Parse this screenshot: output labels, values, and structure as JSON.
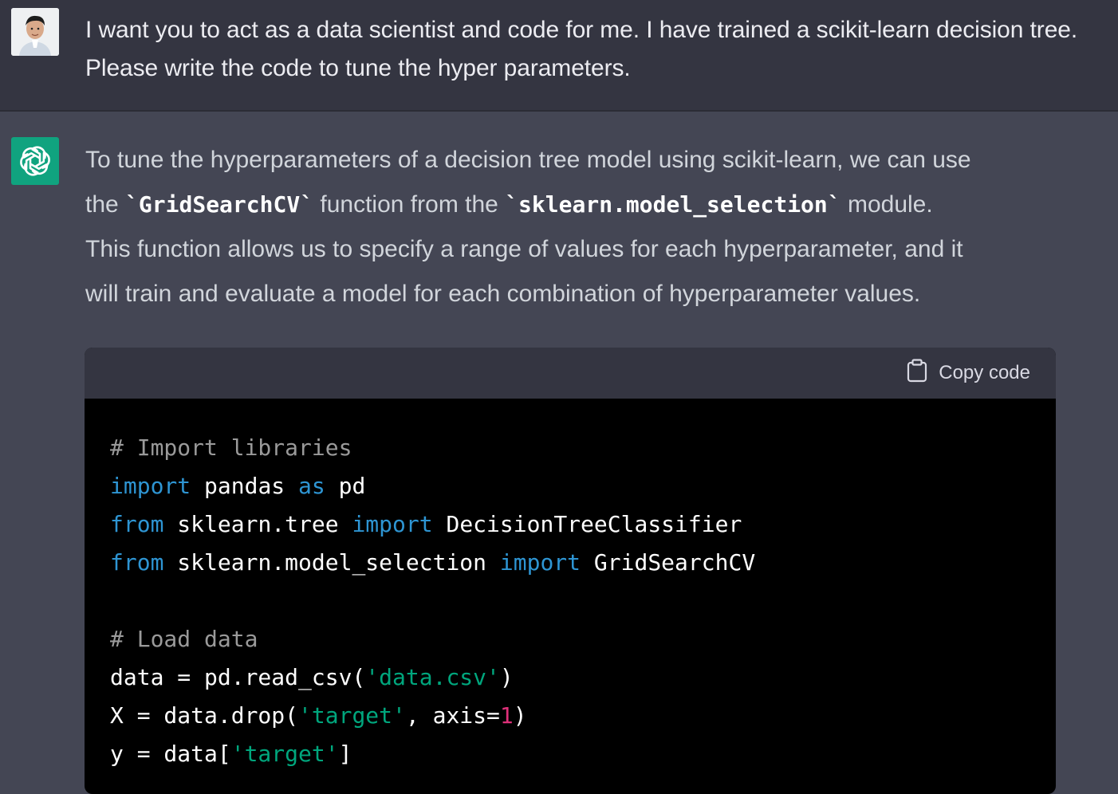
{
  "user_message": {
    "text": "I want you to act as a data scientist and code for me. I have trained a scikit-learn decision tree. Please write the code to tune the hyper parameters."
  },
  "assistant_message": {
    "intro_1": "To tune the hyperparameters of a decision tree model using scikit-learn, we can use",
    "intro_2a": "the ",
    "code_1": "`GridSearchCV`",
    "intro_2b": " function from the ",
    "code_2": "`sklearn.model_selection`",
    "intro_2c": " module.",
    "intro_3": "This function allows us to specify a range of values for each hyperparameter, and it",
    "intro_4": "will train and evaluate a model for each combination of hyperparameter values."
  },
  "code_block": {
    "copy_label": "Copy code",
    "tokens": {
      "c1": "# Import libraries",
      "kw_import": "import",
      "t_pandas": " pandas ",
      "kw_as": "as",
      "t_pd": " pd",
      "kw_from": "from",
      "t_tree": " sklearn.tree ",
      "t_dtc": " DecisionTreeClassifier",
      "t_ms": " sklearn.model_selection ",
      "t_gscv": " GridSearchCV",
      "c2": "# Load data",
      "t_data_read": "data = pd.read_csv(",
      "s_data_csv": "'data.csv'",
      "t_close": ")",
      "t_x_drop": "X = data.drop(",
      "s_target": "'target'",
      "t_axis": ", axis=",
      "n_one": "1",
      "t_y": "y = data[",
      "t_bracket": "]"
    }
  },
  "colors": {
    "keyword": "#2e95d3",
    "string": "#00a67d",
    "number": "#df3079",
    "comment": "#9a9a9a",
    "brand": "#10a37f"
  },
  "icons": {
    "user_avatar": "user-avatar",
    "assistant_logo": "openai-logo-icon",
    "copy": "clipboard-icon"
  }
}
